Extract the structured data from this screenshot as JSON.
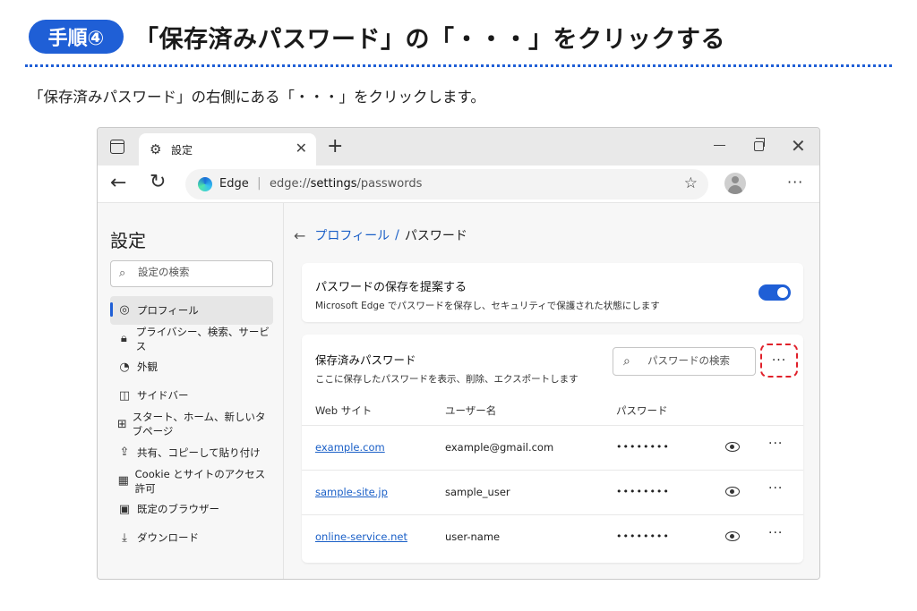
{
  "step": {
    "label": "手順④",
    "title": "「保存済みパスワード」の「・・・」をクリックする",
    "instruction": "「保存済みパスワード」の右側にある「・・・」をクリックします。"
  },
  "browser": {
    "tab": {
      "title": "設定",
      "close": "✕"
    },
    "new_tab": "+",
    "address": {
      "brand": "Edge",
      "url_prefix": "edge://",
      "url_bold": "settings",
      "url_suffix": "/passwords"
    },
    "menu": "···"
  },
  "sidebar": {
    "title": "設定",
    "search_placeholder": "設定の検索",
    "items": [
      {
        "label": "プロフィール",
        "icon": "profile-icon"
      },
      {
        "label": "プライバシー、検索、サービス",
        "icon": "lock-icon"
      },
      {
        "label": "外観",
        "icon": "palette-icon"
      },
      {
        "label": "サイドバー",
        "icon": "sidebar-icon"
      },
      {
        "label": "スタート、ホーム、新しいタブページ",
        "icon": "home-icon"
      },
      {
        "label": "共有、コピーして貼り付け",
        "icon": "share-icon"
      },
      {
        "label": "Cookie とサイトのアクセス許可",
        "icon": "cookie-icon"
      },
      {
        "label": "既定のブラウザー",
        "icon": "browser-icon"
      },
      {
        "label": "ダウンロード",
        "icon": "download-icon"
      }
    ]
  },
  "main": {
    "breadcrumb": {
      "parent": "プロフィール",
      "separator": "/",
      "current": "パスワード"
    },
    "offer_card": {
      "title": "パスワードの保存を提案する",
      "description": "Microsoft Edge でパスワードを保存し、セキュリティで保護された状態にします",
      "toggle_on": true
    },
    "saved_card": {
      "title": "保存済みパスワード",
      "description": "ここに保存したパスワードを表示、削除、エクスポートします",
      "search_placeholder": "パスワードの検索",
      "more": "···",
      "columns": [
        "Web サイト",
        "ユーザー名",
        "パスワード"
      ],
      "rows": [
        {
          "site": "example.com",
          "user": "example@gmail.com",
          "password": "••••••••",
          "more": "···"
        },
        {
          "site": "sample-site.jp",
          "user": "sample_user",
          "password": "••••••••",
          "more": "···"
        },
        {
          "site": "online-service.net",
          "user": "user-name",
          "password": "••••••••",
          "more": "···"
        }
      ]
    }
  },
  "colors": {
    "accent": "#1f5fd6",
    "highlight": "#e0202a",
    "link": "#1a5fc7"
  }
}
